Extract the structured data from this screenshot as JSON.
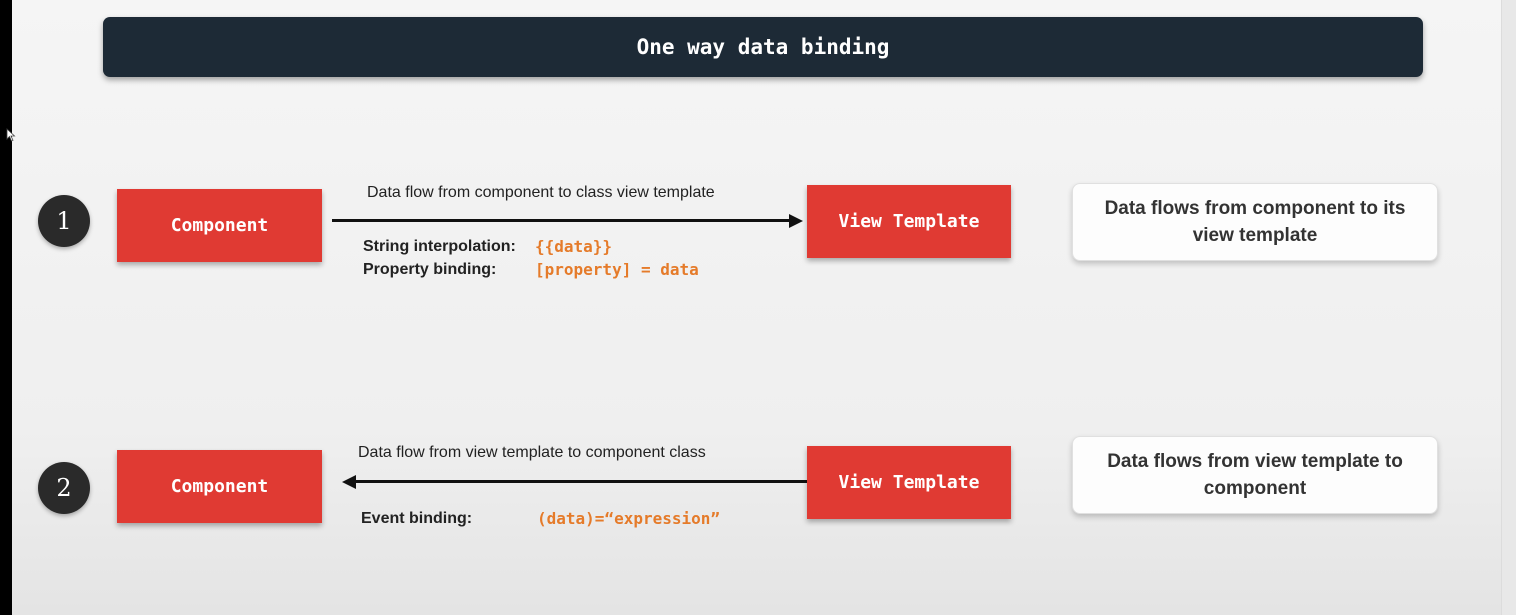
{
  "title": "One way data binding",
  "rows": [
    {
      "number": "1",
      "source": "Component",
      "target": "View Template",
      "flow_label": "Data flow from component to class view template",
      "direction": "right",
      "bindings": [
        {
          "label": "String interpolation:",
          "code": "{{data}}"
        },
        {
          "label": "Property binding:",
          "code": "[property] = data"
        }
      ],
      "note": "Data flows from component to its view template"
    },
    {
      "number": "2",
      "source": "Component",
      "target": "View Template",
      "flow_label": "Data flow from view template to component class",
      "direction": "left",
      "bindings": [
        {
          "label": "Event binding:",
          "code": "(data)=“expression”"
        }
      ],
      "note": "Data flows from view template to component"
    }
  ],
  "colors": {
    "box": "#e03a33",
    "code": "#e57b2a",
    "title_bar": "#1d2a36"
  }
}
